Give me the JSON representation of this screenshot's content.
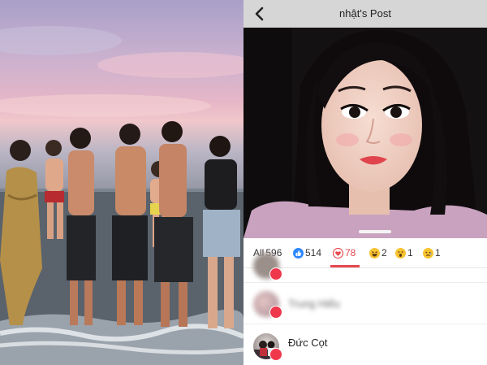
{
  "header": {
    "title": "nhật's Post"
  },
  "reactions": {
    "tabs": [
      {
        "kind": "all",
        "label": "All",
        "count": "596",
        "color": "#333333"
      },
      {
        "kind": "like",
        "label": "",
        "count": "514",
        "color": "#2d88ff"
      },
      {
        "kind": "love",
        "label": "",
        "count": "78",
        "color": "#e8484f"
      },
      {
        "kind": "haha",
        "label": "",
        "count": "2",
        "color": "#f5b915"
      },
      {
        "kind": "wow",
        "label": "",
        "count": "1",
        "color": "#f5b915"
      },
      {
        "kind": "sad",
        "label": "",
        "count": "1",
        "color": "#f5b915"
      }
    ],
    "active_tab": "love"
  },
  "people": [
    {
      "name": "",
      "blurred": true
    },
    {
      "name": "Trung Hiếu",
      "blurred": true
    },
    {
      "name": "Đức Cọt",
      "blurred": false
    }
  ],
  "colors": {
    "accent": "#e8484f",
    "like_blue": "#2d88ff",
    "nav_bg": "#d6d6d6"
  }
}
